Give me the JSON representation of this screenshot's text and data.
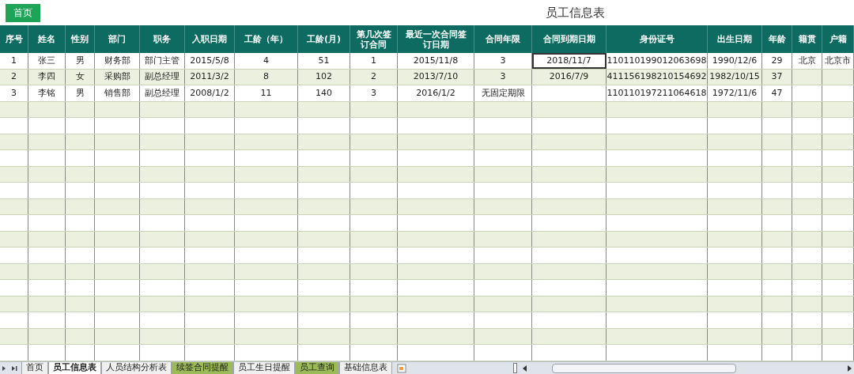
{
  "home_button": "首页",
  "title": "员工信息表",
  "columns": [
    "序号",
    "姓名",
    "性别",
    "部门",
    "职务",
    "入职日期",
    "工龄（年）",
    "工龄(月)",
    "第几次签订合同",
    "最近一次合同签订日期",
    "合同年限",
    "合同到期日期",
    "身份证号",
    "出生日期",
    "年龄",
    "籍贯",
    "户籍"
  ],
  "rows": [
    {
      "cells": [
        {
          "text": "1",
          "selected": false
        },
        {
          "text": "张三",
          "selected": false
        },
        {
          "text": "男",
          "selected": false
        },
        {
          "text": "财务部",
          "selected": false
        },
        {
          "text": "部门主管",
          "selected": false
        },
        {
          "text": "2015/5/8",
          "selected": false
        },
        {
          "text": "4",
          "selected": false
        },
        {
          "text": "51",
          "selected": false
        },
        {
          "text": "1",
          "selected": false
        },
        {
          "text": "2015/11/8",
          "selected": false
        },
        {
          "text": "3",
          "selected": false
        },
        {
          "text": "2018/11/7",
          "selected": true
        },
        {
          "text": "110110199012063698",
          "selected": false
        },
        {
          "text": "1990/12/6",
          "selected": false
        },
        {
          "text": "29",
          "selected": false
        },
        {
          "text": "北京",
          "selected": false
        },
        {
          "text": "北京市",
          "selected": false
        }
      ]
    },
    {
      "cells": [
        {
          "text": "2",
          "selected": false
        },
        {
          "text": "李四",
          "selected": false
        },
        {
          "text": "女",
          "selected": false
        },
        {
          "text": "采购部",
          "selected": false
        },
        {
          "text": "副总经理",
          "selected": false
        },
        {
          "text": "2011/3/2",
          "selected": false
        },
        {
          "text": "8",
          "selected": false
        },
        {
          "text": "102",
          "selected": false
        },
        {
          "text": "2",
          "selected": false
        },
        {
          "text": "2013/7/10",
          "selected": false
        },
        {
          "text": "3",
          "selected": false
        },
        {
          "text": "2016/7/9",
          "selected": false
        },
        {
          "text": "411156198210154692",
          "selected": false
        },
        {
          "text": "1982/10/15",
          "selected": false
        },
        {
          "text": "37",
          "selected": false
        },
        {
          "selected": false
        },
        {
          "selected": false
        }
      ]
    },
    {
      "cells": [
        {
          "text": "3",
          "selected": false
        },
        {
          "text": "李铭",
          "selected": false
        },
        {
          "text": "男",
          "selected": false
        },
        {
          "text": "销售部",
          "selected": false
        },
        {
          "text": "副总经理",
          "selected": false
        },
        {
          "text": "2008/1/2",
          "selected": false
        },
        {
          "text": "11",
          "selected": false
        },
        {
          "text": "140",
          "selected": false
        },
        {
          "text": "3",
          "selected": false
        },
        {
          "text": "2016/1/2",
          "selected": false
        },
        {
          "text": "无固定期限",
          "selected": false
        },
        {
          "selected": false
        },
        {
          "text": "110110197211064618",
          "selected": false
        },
        {
          "text": "1972/11/6",
          "selected": false
        },
        {
          "text": "47",
          "selected": false
        },
        {
          "selected": false
        },
        {
          "selected": false
        }
      ]
    }
  ],
  "sheet_tabs": [
    {
      "label": "首页",
      "selected": false,
      "color": "#f0f0f0"
    },
    {
      "label": "员工信息表",
      "selected": true,
      "color": "#ffffff"
    },
    {
      "label": "人员结构分析表",
      "selected": false,
      "color": "#f0f0f0"
    },
    {
      "label": "续签合同提醒",
      "selected": false,
      "color": "#9bbb59"
    },
    {
      "label": "员工生日提醒",
      "selected": false,
      "color": "#f0f0f0"
    },
    {
      "label": "员工查询",
      "selected": false,
      "color": "#9bbb59"
    },
    {
      "label": "基础信息表",
      "selected": false,
      "color": "#f0f0f0"
    }
  ]
}
